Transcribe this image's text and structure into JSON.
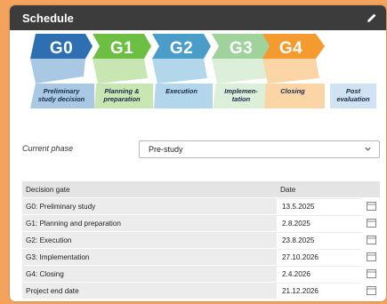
{
  "panel": {
    "title": "Schedule",
    "edit_icon": "pencil-icon"
  },
  "phases": [
    {
      "code": "G0",
      "label_l1": "Preliminary",
      "label_l2": "study decision",
      "color": "#2d6fb0",
      "color_light": "#a9c8e4"
    },
    {
      "code": "G1",
      "label_l1": "Planning &",
      "label_l2": "preparation",
      "color": "#6cbf42",
      "color_light": "#c7e6b1"
    },
    {
      "code": "G2",
      "label_l1": "Execution",
      "label_l2": "",
      "color": "#4a9cc9",
      "color_light": "#b2d6ea"
    },
    {
      "code": "G3",
      "label_l1": "Implemen-",
      "label_l2": "tation",
      "color": "#9fd39b",
      "color_light": "#dbefd9"
    },
    {
      "code": "G4",
      "label_l1": "Closing",
      "label_l2": "",
      "color": "#f49a2e",
      "color_light": "#fbd5a6"
    }
  ],
  "post": {
    "label_l1": "Post",
    "label_l2": "evaluation",
    "color_light": "#cfe3f3"
  },
  "current_phase": {
    "label": "Current phase",
    "value": "Pre-study"
  },
  "table": {
    "headers": [
      "Decision gate",
      "Date"
    ],
    "rows": [
      {
        "gate": "G0: Preliminary study",
        "date": "13.5.2025"
      },
      {
        "gate": "G1: Planning and preparation",
        "date": "2.8.2025"
      },
      {
        "gate": "G2: Execution",
        "date": "23.8.2025"
      },
      {
        "gate": "G3: Implementation",
        "date": "27.10.2026"
      },
      {
        "gate": "G4: Closing",
        "date": "2.4.2026"
      },
      {
        "gate": "Project end date",
        "date": "21.12.2026"
      }
    ]
  },
  "colors": {
    "background": "#f3a35c",
    "titlebar": "#3c3c3c"
  }
}
